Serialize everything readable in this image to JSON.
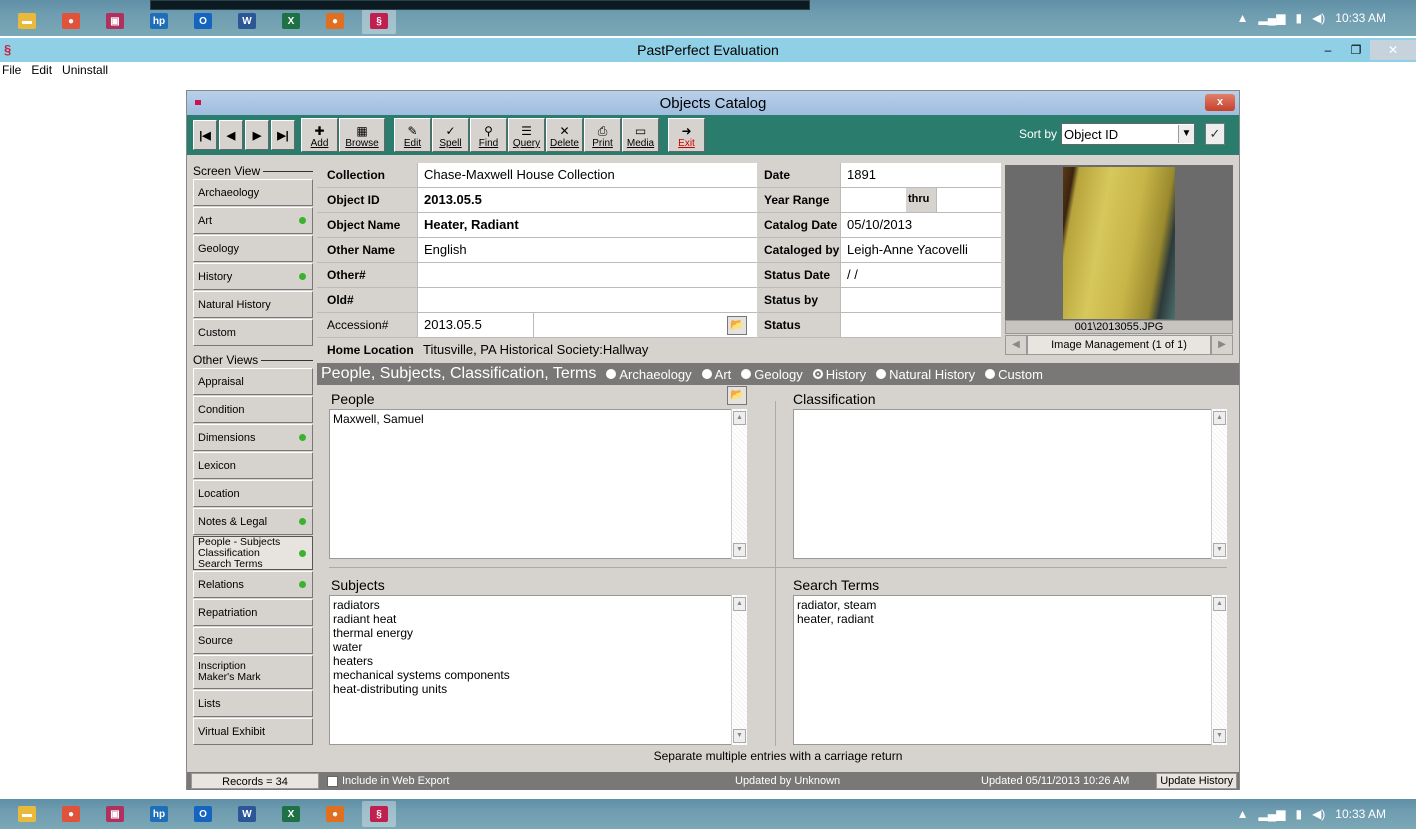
{
  "taskbar": {
    "apps": [
      "file-explorer",
      "chrome",
      "presentation",
      "hp",
      "outlook",
      "word",
      "excel",
      "firefox",
      "pastperfect"
    ],
    "tray_time": "10:33 AM"
  },
  "app": {
    "title": "PastPerfect Evaluation",
    "menu": [
      "File",
      "Edit",
      "Uninstall"
    ]
  },
  "catalog": {
    "title": "Objects Catalog",
    "close_label": "x",
    "nav": [
      "|◀",
      "◀",
      "▶",
      "▶|"
    ],
    "tools": [
      {
        "icon": "✚",
        "label": "Add"
      },
      {
        "icon": "▦",
        "label": "Browse"
      },
      {
        "icon": "✎",
        "label": "Edit"
      },
      {
        "icon": "✓",
        "label": "Spell"
      },
      {
        "icon": "⚲",
        "label": "Find"
      },
      {
        "icon": "☰",
        "label": "Query"
      },
      {
        "icon": "✕",
        "label": "Delete"
      },
      {
        "icon": "⎙",
        "label": "Print"
      },
      {
        "icon": "▭",
        "label": "Media"
      },
      {
        "icon": "➜",
        "label": "Exit"
      }
    ],
    "sort_label": "Sort by",
    "sort_value": "Object ID"
  },
  "screen_view": {
    "heading": "Screen View",
    "items": [
      {
        "label": "Archaeology",
        "dot": false
      },
      {
        "label": "Art",
        "dot": true
      },
      {
        "label": "Geology",
        "dot": false
      },
      {
        "label": "History",
        "dot": true
      },
      {
        "label": "Natural History",
        "dot": false
      },
      {
        "label": "Custom",
        "dot": false
      }
    ]
  },
  "other_views": {
    "heading": "Other Views",
    "items": [
      {
        "label": "Appraisal",
        "dot": false
      },
      {
        "label": "Condition",
        "dot": false
      },
      {
        "label": "Dimensions",
        "dot": true
      },
      {
        "label": "Lexicon",
        "dot": false
      },
      {
        "label": "Location",
        "dot": false
      },
      {
        "label": "Notes & Legal",
        "dot": true
      },
      {
        "label": "People - Subjects\nClassification\nSearch Terms",
        "dot": true
      },
      {
        "label": "Relations",
        "dot": true
      },
      {
        "label": "Repatriation",
        "dot": false
      },
      {
        "label": "Source",
        "dot": false
      },
      {
        "label": "Inscription\nMaker's Mark",
        "dot": false
      },
      {
        "label": "Lists",
        "dot": false
      },
      {
        "label": "Virtual Exhibit",
        "dot": false
      }
    ]
  },
  "fields": {
    "collection_label": "Collection",
    "collection": "Chase-Maxwell House Collection",
    "object_id_label": "Object ID",
    "object_id": "2013.05.5",
    "object_name_label": "Object Name",
    "object_name": "Heater, Radiant",
    "other_name_label": "Other Name",
    "other_name": "English",
    "other_num_label": "Other#",
    "other_num": "",
    "old_num_label": "Old#",
    "old_num": "",
    "accession_label": "Accession#",
    "accession": "2013.05.5",
    "accession2": "",
    "home_location_label": "Home Location",
    "home_location": "Titusville, PA Historical Society:Hallway",
    "date_label": "Date",
    "date": "1891",
    "year_range_label": "Year Range",
    "year_range_thru": "thru",
    "catalog_date_label": "Catalog Date",
    "catalog_date": "05/10/2013",
    "cataloged_by_label": "Cataloged by",
    "cataloged_by": "Leigh-Anne Yacovelli",
    "status_date_label": "Status Date",
    "status_date": "/ /",
    "status_by_label": "Status by",
    "status_by": "",
    "status_label": "Status",
    "status": ""
  },
  "image": {
    "filename": "001\\2013055.JPG",
    "management": "Image Management (1 of 1)"
  },
  "section": {
    "title": "People, Subjects, Classification, Terms",
    "options": [
      {
        "label": "Archaeology",
        "selected": false
      },
      {
        "label": "Art",
        "selected": false
      },
      {
        "label": "Geology",
        "selected": false
      },
      {
        "label": "History",
        "selected": true
      },
      {
        "label": "Natural History",
        "selected": false
      },
      {
        "label": "Custom",
        "selected": false
      }
    ],
    "people_title": "People",
    "people": "Maxwell, Samuel",
    "classification_title": "Classification",
    "classification": "",
    "subjects_title": "Subjects",
    "subjects": "radiators\nradiant heat\nthermal energy\nwater\nheaters\nmechanical systems components\nheat-distributing units",
    "search_terms_title": "Search Terms",
    "search_terms": "radiator, steam\nheater, radiant",
    "hint": "Separate multiple entries with a carriage return"
  },
  "statusbar": {
    "records": "Records = 34",
    "web_export": "Include in Web Export",
    "updated_by": "Updated by  Unknown",
    "updated": "Updated   05/11/2013 10:26 AM",
    "update_history": "Update History"
  }
}
